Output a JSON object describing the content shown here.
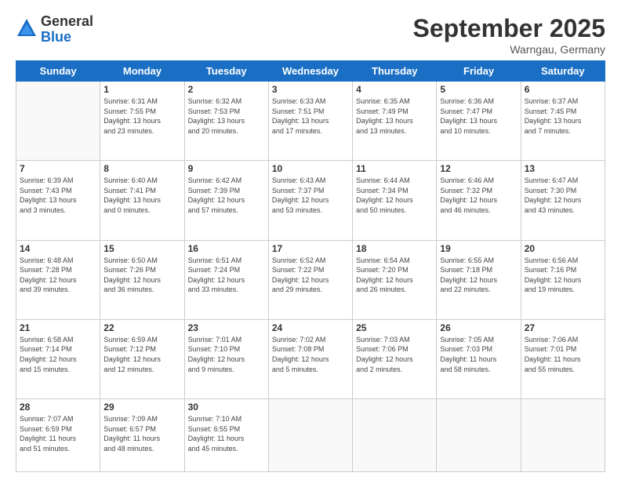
{
  "logo": {
    "general": "General",
    "blue": "Blue"
  },
  "title": "September 2025",
  "location": "Warngau, Germany",
  "days_of_week": [
    "Sunday",
    "Monday",
    "Tuesday",
    "Wednesday",
    "Thursday",
    "Friday",
    "Saturday"
  ],
  "weeks": [
    [
      {
        "num": "",
        "info": ""
      },
      {
        "num": "1",
        "info": "Sunrise: 6:31 AM\nSunset: 7:55 PM\nDaylight: 13 hours\nand 23 minutes."
      },
      {
        "num": "2",
        "info": "Sunrise: 6:32 AM\nSunset: 7:53 PM\nDaylight: 13 hours\nand 20 minutes."
      },
      {
        "num": "3",
        "info": "Sunrise: 6:33 AM\nSunset: 7:51 PM\nDaylight: 13 hours\nand 17 minutes."
      },
      {
        "num": "4",
        "info": "Sunrise: 6:35 AM\nSunset: 7:49 PM\nDaylight: 13 hours\nand 13 minutes."
      },
      {
        "num": "5",
        "info": "Sunrise: 6:36 AM\nSunset: 7:47 PM\nDaylight: 13 hours\nand 10 minutes."
      },
      {
        "num": "6",
        "info": "Sunrise: 6:37 AM\nSunset: 7:45 PM\nDaylight: 13 hours\nand 7 minutes."
      }
    ],
    [
      {
        "num": "7",
        "info": "Sunrise: 6:39 AM\nSunset: 7:43 PM\nDaylight: 13 hours\nand 3 minutes."
      },
      {
        "num": "8",
        "info": "Sunrise: 6:40 AM\nSunset: 7:41 PM\nDaylight: 13 hours\nand 0 minutes."
      },
      {
        "num": "9",
        "info": "Sunrise: 6:42 AM\nSunset: 7:39 PM\nDaylight: 12 hours\nand 57 minutes."
      },
      {
        "num": "10",
        "info": "Sunrise: 6:43 AM\nSunset: 7:37 PM\nDaylight: 12 hours\nand 53 minutes."
      },
      {
        "num": "11",
        "info": "Sunrise: 6:44 AM\nSunset: 7:34 PM\nDaylight: 12 hours\nand 50 minutes."
      },
      {
        "num": "12",
        "info": "Sunrise: 6:46 AM\nSunset: 7:32 PM\nDaylight: 12 hours\nand 46 minutes."
      },
      {
        "num": "13",
        "info": "Sunrise: 6:47 AM\nSunset: 7:30 PM\nDaylight: 12 hours\nand 43 minutes."
      }
    ],
    [
      {
        "num": "14",
        "info": "Sunrise: 6:48 AM\nSunset: 7:28 PM\nDaylight: 12 hours\nand 39 minutes."
      },
      {
        "num": "15",
        "info": "Sunrise: 6:50 AM\nSunset: 7:26 PM\nDaylight: 12 hours\nand 36 minutes."
      },
      {
        "num": "16",
        "info": "Sunrise: 6:51 AM\nSunset: 7:24 PM\nDaylight: 12 hours\nand 33 minutes."
      },
      {
        "num": "17",
        "info": "Sunrise: 6:52 AM\nSunset: 7:22 PM\nDaylight: 12 hours\nand 29 minutes."
      },
      {
        "num": "18",
        "info": "Sunrise: 6:54 AM\nSunset: 7:20 PM\nDaylight: 12 hours\nand 26 minutes."
      },
      {
        "num": "19",
        "info": "Sunrise: 6:55 AM\nSunset: 7:18 PM\nDaylight: 12 hours\nand 22 minutes."
      },
      {
        "num": "20",
        "info": "Sunrise: 6:56 AM\nSunset: 7:16 PM\nDaylight: 12 hours\nand 19 minutes."
      }
    ],
    [
      {
        "num": "21",
        "info": "Sunrise: 6:58 AM\nSunset: 7:14 PM\nDaylight: 12 hours\nand 15 minutes."
      },
      {
        "num": "22",
        "info": "Sunrise: 6:59 AM\nSunset: 7:12 PM\nDaylight: 12 hours\nand 12 minutes."
      },
      {
        "num": "23",
        "info": "Sunrise: 7:01 AM\nSunset: 7:10 PM\nDaylight: 12 hours\nand 9 minutes."
      },
      {
        "num": "24",
        "info": "Sunrise: 7:02 AM\nSunset: 7:08 PM\nDaylight: 12 hours\nand 5 minutes."
      },
      {
        "num": "25",
        "info": "Sunrise: 7:03 AM\nSunset: 7:06 PM\nDaylight: 12 hours\nand 2 minutes."
      },
      {
        "num": "26",
        "info": "Sunrise: 7:05 AM\nSunset: 7:03 PM\nDaylight: 11 hours\nand 58 minutes."
      },
      {
        "num": "27",
        "info": "Sunrise: 7:06 AM\nSunset: 7:01 PM\nDaylight: 11 hours\nand 55 minutes."
      }
    ],
    [
      {
        "num": "28",
        "info": "Sunrise: 7:07 AM\nSunset: 6:59 PM\nDaylight: 11 hours\nand 51 minutes."
      },
      {
        "num": "29",
        "info": "Sunrise: 7:09 AM\nSunset: 6:57 PM\nDaylight: 11 hours\nand 48 minutes."
      },
      {
        "num": "30",
        "info": "Sunrise: 7:10 AM\nSunset: 6:55 PM\nDaylight: 11 hours\nand 45 minutes."
      },
      {
        "num": "",
        "info": ""
      },
      {
        "num": "",
        "info": ""
      },
      {
        "num": "",
        "info": ""
      },
      {
        "num": "",
        "info": ""
      }
    ]
  ]
}
